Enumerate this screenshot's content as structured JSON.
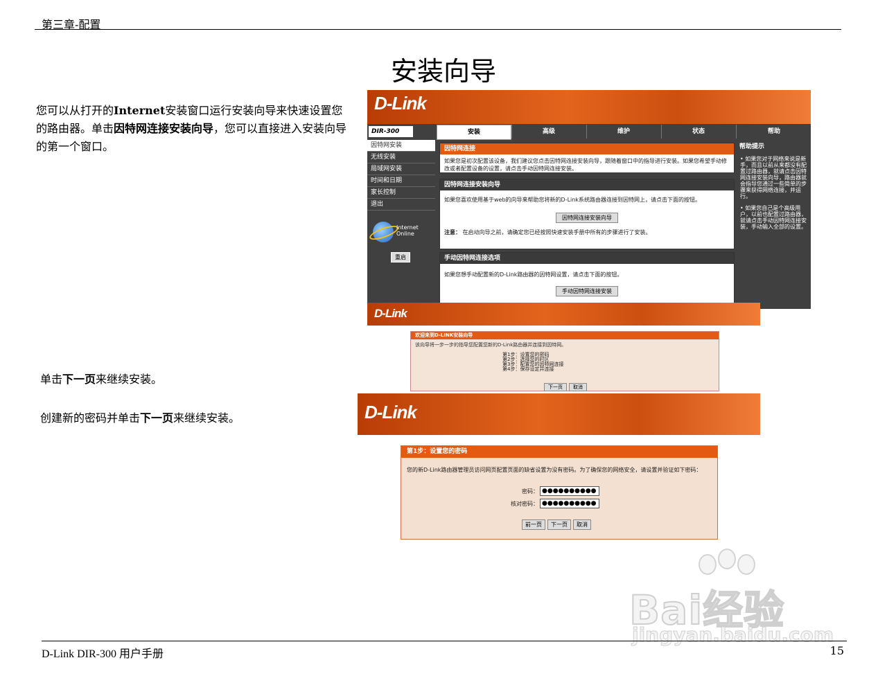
{
  "header": {
    "chapter": "第三章-配置"
  },
  "title": "安装向导",
  "intro": {
    "p1_a": "您可以从打开的",
    "p1_b": "Internet",
    "p1_c": "安装窗口运行安装向导来快速设置您的路由器。单击",
    "p1_d": "因特网连接安装向导",
    "p1_e": "，您可以直接进入安装向导的第一个窗口。"
  },
  "step_next": {
    "a": "单击",
    "b": "下一页",
    "c": "来继续安装。"
  },
  "step_pw": {
    "a": "创建新的密码并单击",
    "b": "下一页",
    "c": "来继续安装。"
  },
  "router": {
    "logo": "D-Link",
    "model": "DIR-300",
    "tabs": [
      "安装",
      "高级",
      "维护",
      "状态",
      "帮助"
    ],
    "side_items": [
      "因特网安装",
      "无线安装",
      "局域网安装",
      "时间和日期",
      "家长控制",
      "退出"
    ],
    "internet_status": [
      "Internet",
      "Online"
    ],
    "reboot": "重启",
    "sec1_title": "因特网连接",
    "sec1_body": "如果您是初次配置该设备，我们建议您点击因特网连接安装向导，跟随着窗口中的指导进行安装。如果您希望手动修改或者配置设备的设置，请点击手动因特网连接安装。",
    "sec2_title": "因特网连接安装向导",
    "sec2_body": "如果您喜欢使用基于web的向导来帮助您将新的D-Link系统路由器连接到因特网上，请点击下面的按钮。",
    "sec2_button": "因特网连接安装向导",
    "sec2_note_label": "注意：",
    "sec2_note": "在启动向导之前，请确定您已经按照快速安装手册中所有的步骤进行了安装。",
    "sec3_title": "手动因特网连接选项",
    "sec3_body": "如果您想手动配置新的D-Link路由器的因特网设置，请点击下面的按钮。",
    "sec3_button": "手动因特网连接安装",
    "help_title": "帮助提示",
    "help_p1": "• 如果您对于网络来说是新手，而且以前从来都没有配置过路由器，就请点击因特网连接安装向导，路由器就会指导您通过一些简单的步骤来获得网络连接，并运行。",
    "help_p2": "• 如果您自己是个高级用户，以前也配置过路由器，就请点击手动因特网连接安装，手动输入全部的设置。"
  },
  "wizard": {
    "logo": "D-Link",
    "title": "欢迎来到D-LINK安装向导",
    "desc": "该向导将一步一步的指导您配置您新的D-Link路由器并连接到因特网。",
    "steps": [
      "第1步：设置您的密码",
      "第2步：选择您的时区",
      "第3步：配置您的因特网连接",
      "第4步：保存设定并连接"
    ],
    "next": "下一页",
    "cancel": "取消"
  },
  "password": {
    "logo": "D-Link",
    "title": "第1步：设置您的密码",
    "desc": "您的新D-Link路由器管理员访问网页配置页面的缺省设置为没有密码。为了确保您的网络安全，请设置并验证如下密码：",
    "pw_label": "密码：",
    "pw_value": "●●●●●●●●●●",
    "verify_label": "核对密码：",
    "verify_value": "●●●●●●●●●●",
    "prev": "前一页",
    "next": "下一页",
    "cancel": "取消"
  },
  "footer": {
    "left": "D-Link DIR-300  用户手册",
    "page": "15"
  },
  "watermark": {
    "brand": "Bai经验",
    "url": "jingyan.baidu.com"
  }
}
